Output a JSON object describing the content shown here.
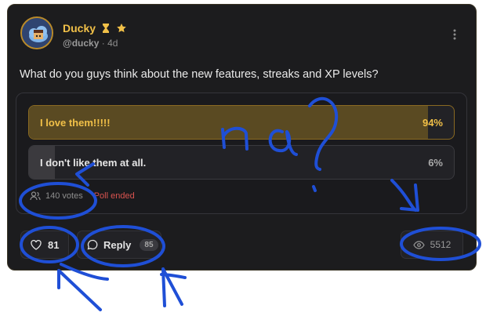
{
  "post": {
    "author": {
      "display_name": "Ducky",
      "handle": "@ducky",
      "time_ago": "4d",
      "separator": "·",
      "badges": [
        "hourglass-icon",
        "star-icon"
      ]
    },
    "question": "What do you guys think about the new features, streaks and XP levels?",
    "poll": {
      "options": [
        {
          "label": "I love them!!!!!",
          "percent_label": "94%",
          "percent": 94,
          "winner": true
        },
        {
          "label": "I don't like them at all.",
          "percent_label": "6%",
          "percent": 6,
          "winner": false
        }
      ],
      "votes": "140 votes",
      "status": "Poll ended"
    },
    "actions": {
      "likes": "81",
      "reply_label": "Reply",
      "reply_count": "85",
      "views": "5512"
    }
  },
  "annotation": {
    "scribble_text": "na?",
    "color": "#1f4fd6"
  },
  "colors": {
    "accent": "#f1c048",
    "card_bg": "#1c1c1e",
    "ended": "#d9534f"
  }
}
